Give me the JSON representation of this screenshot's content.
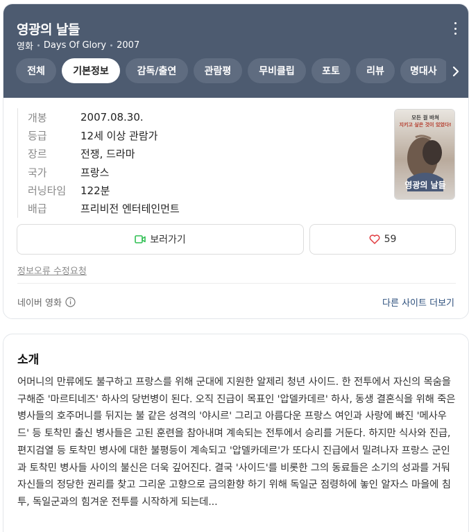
{
  "header": {
    "title": "영광의 날들",
    "category": "영화",
    "english_title": "Days Of Glory",
    "year": "2007"
  },
  "tabs": [
    {
      "label": "전체",
      "active": false
    },
    {
      "label": "기본정보",
      "active": true
    },
    {
      "label": "감독/출연",
      "active": false
    },
    {
      "label": "관람평",
      "active": false
    },
    {
      "label": "무비클립",
      "active": false
    },
    {
      "label": "포토",
      "active": false
    },
    {
      "label": "리뷰",
      "active": false
    },
    {
      "label": "명대사",
      "active": false
    }
  ],
  "info": [
    {
      "key": "개봉",
      "value": "2007.08.30."
    },
    {
      "key": "등급",
      "value": "12세 이상 관람가"
    },
    {
      "key": "장르",
      "value": "전쟁, 드라마"
    },
    {
      "key": "국가",
      "value": "프랑스"
    },
    {
      "key": "러닝타임",
      "value": "122분"
    },
    {
      "key": "배급",
      "value": "프리비전 엔터테인먼트"
    }
  ],
  "poster": {
    "tagline_line1": "모든 걸 바쳐",
    "tagline_line2": "지키고 싶은 것이 있었다!",
    "title": "영광의 날들"
  },
  "actions": {
    "watch_label": "보러가기",
    "like_count": "59"
  },
  "report_label": "정보오류 수정요청",
  "source_label": "네이버 영화",
  "other_sites_label": "다른 사이트 더보기",
  "intro": {
    "heading": "소개",
    "body": "어머니의 만류에도 불구하고 프랑스를 위해 군대에 지원한 알제리 청년 사이드. 한 전투에서 자신의 목숨을 구해준 '마르티네즈' 하사의 당번병이 된다. 오직 진급이 목표인 '압델카데르' 하사, 동생 결혼식을 위해 죽은 병사들의 호주머니를 뒤지는 불 같은 성격의 '야시르' 그리고 아름다운 프랑스 여인과 사랑에 빠진 '메사우드' 등 토착민 출신 병사들은 고된 훈련을 참아내며 계속되는 전투에서 승리를 거둔다. 하지만 식사와 진급, 편지검열 등 토착민 병사에 대한 불평등이 계속되고 '압델카데르'가 또다시 진급에서 밀려나자 프랑스 군인과 토착민 병사들 사이의 불신은 더욱 깊어진다. 결국 '사이드'를 비롯한 그의 동료들은 소기의 성과를 거둬 자신들의 정당한 권리를 찾고 그리운 고향으로 금의환향 하기 위해 독일군 점령하에 놓인 알자스 마을에 침투, 독일군과의 힘겨운 전투를 시작하게 되는데..."
  },
  "colors": {
    "hero_bg": "#4d5b70",
    "tab_bg": "#5f6c80",
    "link": "#2c4f7c",
    "watch_icon": "#2fbf52",
    "heart": "#e0393e"
  }
}
